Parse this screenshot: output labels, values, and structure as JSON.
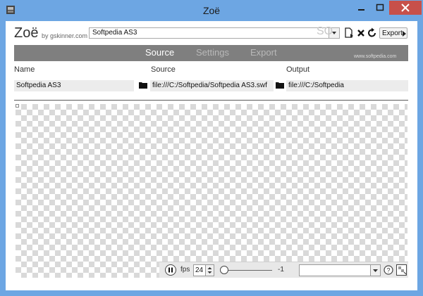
{
  "window": {
    "title": "Zoë"
  },
  "header": {
    "logo": "Zoë",
    "logo_by": "by gskinner.com",
    "project_value": "Softpedia AS3",
    "watermark": "SO",
    "export_label": "Export"
  },
  "tabs": [
    {
      "label": "Source",
      "active": true
    },
    {
      "label": "Settings",
      "active": false
    },
    {
      "label": "Export",
      "active": false
    }
  ],
  "tab_watermark": "www.softpedia.com",
  "columns": {
    "name": "Name",
    "source": "Source",
    "output": "Output"
  },
  "fields": {
    "name": "Softpedia AS3",
    "source": "file:///C:/Softpedia/Softpedia AS3.swf",
    "output": "file:///C:/Softpedia"
  },
  "player": {
    "fps_label": "fps",
    "fps_value": "24",
    "frame_value": "-1",
    "frame_select_value": ""
  },
  "colors": {
    "titlebar": "#6da6e3",
    "close": "#c7504a",
    "tabbar": "#7f7f7f"
  }
}
